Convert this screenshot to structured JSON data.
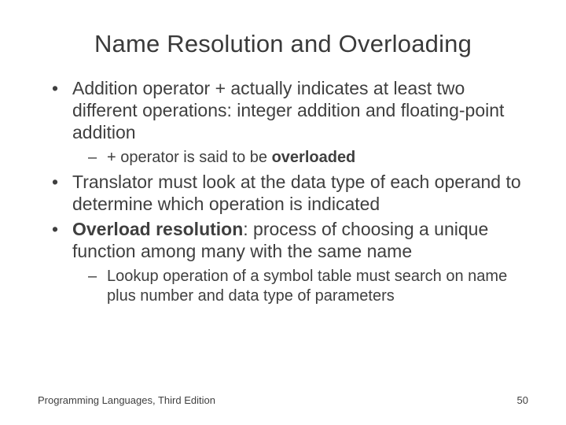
{
  "title": "Name Resolution and Overloading",
  "bullets": {
    "b1": "Addition operator + actually indicates at least two different operations: integer addition and floating-point addition",
    "b1s1_pre": "+ operator is said to be ",
    "b1s1_bold": "overloaded",
    "b2": "Translator must look at the data type of each operand to determine which operation is indicated",
    "b3_bold": "Overload resolution",
    "b3_rest": ": process of choosing a unique function among many with the same name",
    "b3s1": "Lookup operation of a symbol table must search on name plus number and data type of parameters"
  },
  "footer": {
    "left": "Programming Languages, Third Edition",
    "right": "50"
  }
}
